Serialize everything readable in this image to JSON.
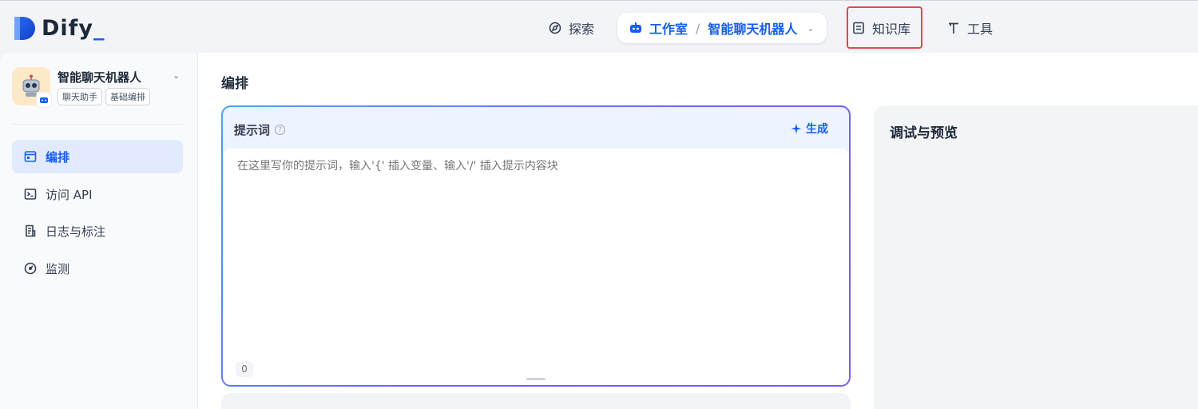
{
  "brand": {
    "name": "Dify",
    "accent": "#155eef"
  },
  "topnav": {
    "explore": "探索",
    "studio": "工作室",
    "separator": "/",
    "current_app": "智能聊天机器人",
    "knowledge": "知识库",
    "tools": "工具"
  },
  "sidebar": {
    "app_name": "智能聊天机器人",
    "tags": [
      "聊天助手",
      "基础编排"
    ],
    "items": [
      {
        "label": "编排",
        "icon": "layout-icon",
        "active": true
      },
      {
        "label": "访问 API",
        "icon": "terminal-icon",
        "active": false
      },
      {
        "label": "日志与标注",
        "icon": "file-list-icon",
        "active": false
      },
      {
        "label": "监测",
        "icon": "gauge-icon",
        "active": false
      }
    ]
  },
  "main": {
    "title": "编排",
    "prompt": {
      "label": "提示词",
      "generate": "生成",
      "placeholder": "在这里写你的提示词，输入'{' 插入变量、输入'/' 插入提示内容块",
      "char_count": "0"
    },
    "debug": {
      "title": "调试与预览"
    }
  }
}
